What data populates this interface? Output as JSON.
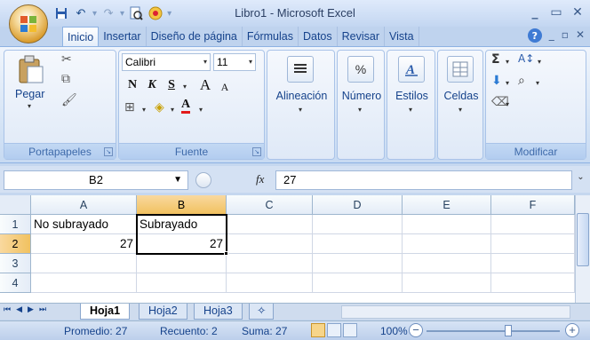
{
  "window": {
    "title": "Libro1 - Microsoft Excel"
  },
  "tabs": [
    "Inicio",
    "Insertar",
    "Diseño de página",
    "Fórmulas",
    "Datos",
    "Revisar",
    "Vista"
  ],
  "ribbon": {
    "clipboard": {
      "paste_label": "Pegar",
      "group_label": "Portapapeles"
    },
    "font": {
      "font_name": "Calibri",
      "font_size": "11",
      "bold": "N",
      "italic": "K",
      "underline": "S",
      "grow": "A",
      "shrink": "A",
      "group_label": "Fuente"
    },
    "alignment_label": "Alineación",
    "number_label": "Número",
    "styles_label": "Estilos",
    "cells_label": "Celdas",
    "editing_group_label": "Modificar"
  },
  "formula_bar": {
    "name_box": "B2",
    "fx": "fx",
    "value": "27"
  },
  "sheet": {
    "columns": [
      "A",
      "B",
      "C",
      "D",
      "E",
      "F"
    ],
    "rows": [
      "1",
      "2",
      "3",
      "4"
    ],
    "cells": {
      "A1": "No subrayado",
      "B1": "Subrayado",
      "A2": "27",
      "B2": "27"
    },
    "active_cell": "B2"
  },
  "sheet_tabs": [
    "Hoja1",
    "Hoja2",
    "Hoja3"
  ],
  "status": {
    "average": "Promedio: 27",
    "count": "Recuento: 2",
    "sum": "Suma: 27",
    "zoom": "100%"
  }
}
